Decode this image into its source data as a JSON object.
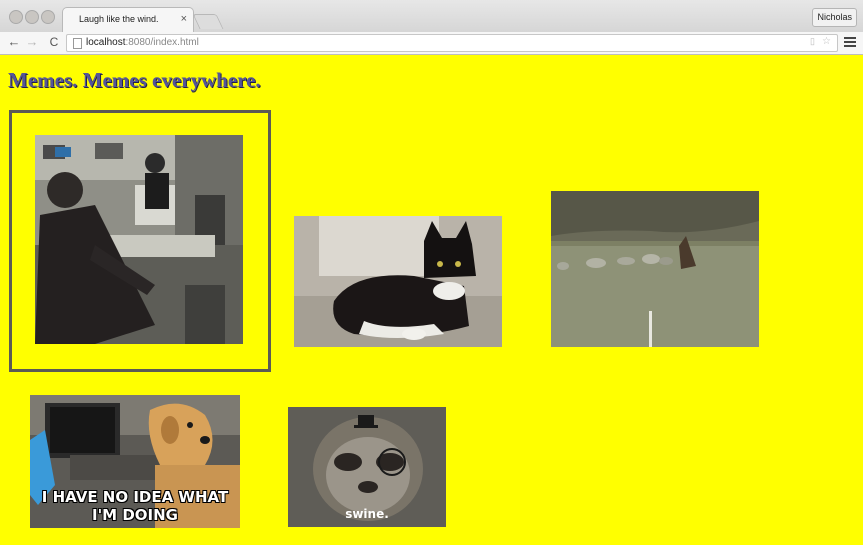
{
  "browser": {
    "tab_title": "Laugh like the wind.",
    "tab_close": "×",
    "profile_name": "Nicholas",
    "url_host": "localhost",
    "url_port": ":8080",
    "url_path": "/index.html",
    "back_glyph": "←",
    "forward_glyph": "→",
    "reload_glyph": "C"
  },
  "page": {
    "heading": "Memes. Memes everywhere.",
    "background_color": "#ffff00",
    "memes": [
      {
        "name": "office-guy-falling-meme",
        "caption": ""
      },
      {
        "name": "batman-cat-meme",
        "caption": ""
      },
      {
        "name": "field-chicken-meme",
        "caption": ""
      },
      {
        "name": "dog-at-computer-meme",
        "caption": "I HAVE NO IDEA WHAT I'M DOING"
      },
      {
        "name": "sloth-monocle-meme",
        "caption": "swine."
      }
    ]
  }
}
